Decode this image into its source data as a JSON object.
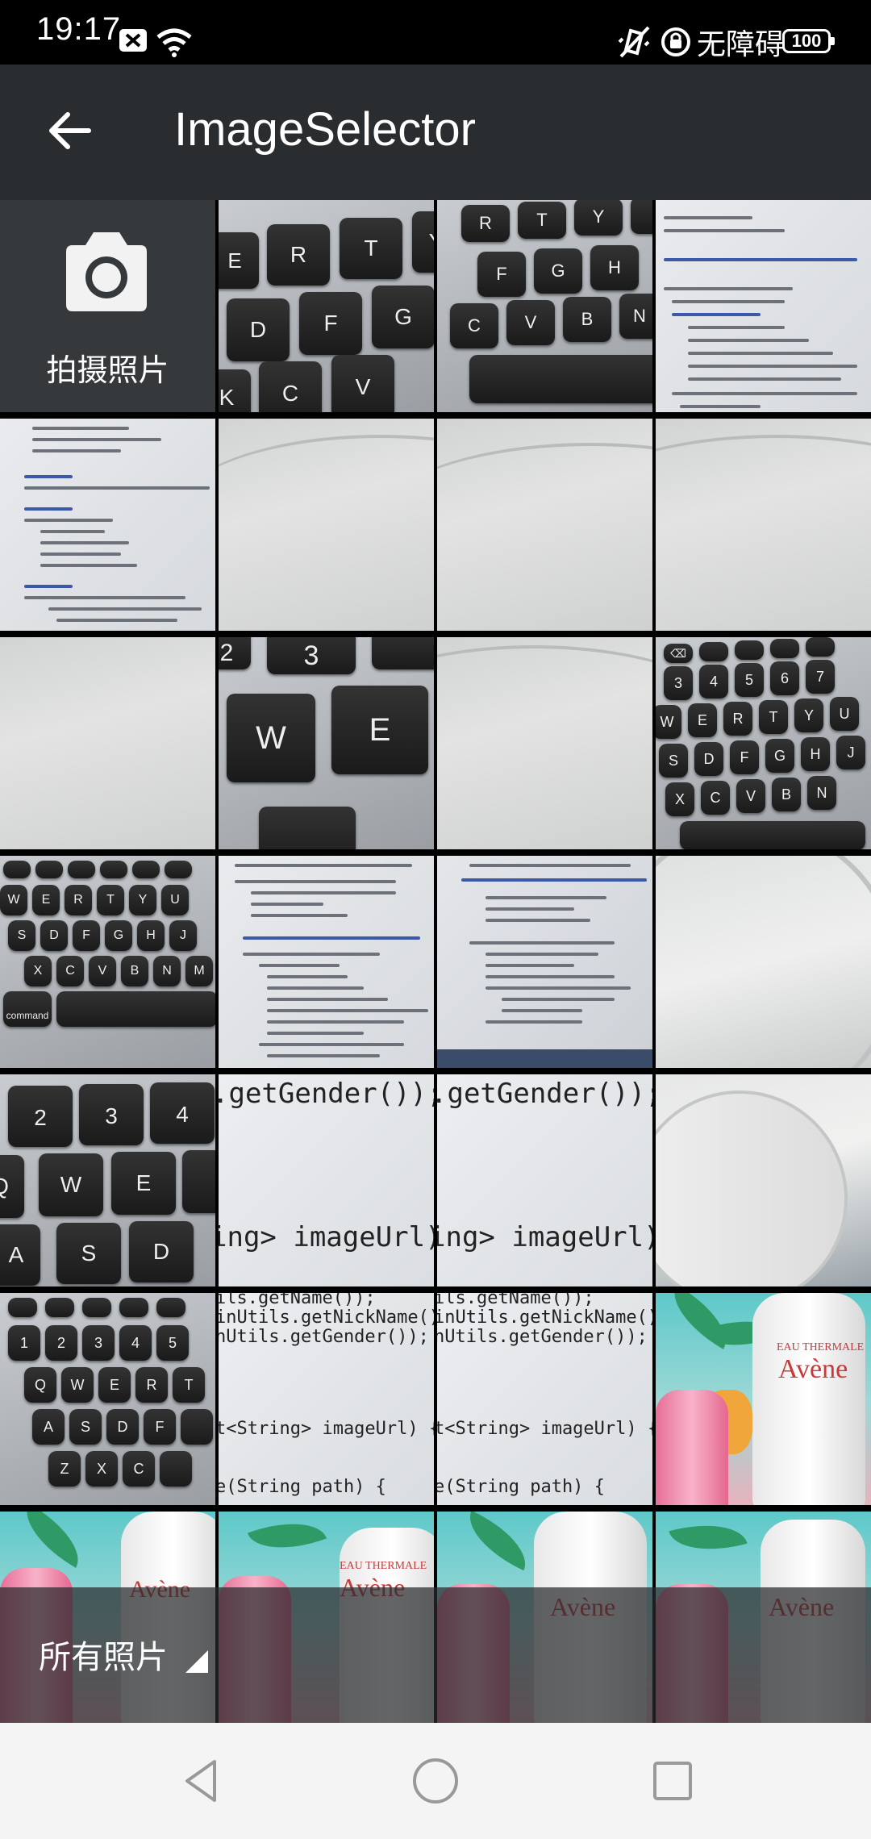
{
  "status_bar": {
    "time": "19:17",
    "accessibility_text": "无障碍",
    "battery": "100",
    "icons": [
      "notification-x-icon",
      "wifi-icon",
      "vibrate-icon",
      "lock-rotation-icon"
    ]
  },
  "app_bar": {
    "title": "ImageSelector",
    "back_icon": "arrow-back-icon"
  },
  "grid": {
    "camera_label": "拍摄照片",
    "code_texts": {
      "gender": ".getGender());",
      "image_url": "ing> imageUrl) {",
      "get_name": "ils.getName());",
      "get_nick": "inUtils.getNickName());",
      "get_gender2": "nUtils.getGender());",
      "image_url2": "t<String> imageUrl) { }",
      "path": "e(String path) {"
    },
    "brand_text": "Avène",
    "brand_sub": "EAU THERMALE"
  },
  "album_bar": {
    "album_name": "所有照片"
  },
  "nav_bar": {
    "icons": [
      "back-triangle-icon",
      "home-circle-icon",
      "recents-square-icon"
    ]
  },
  "colors": {
    "app_bar_bg": "#2a2d30",
    "camera_cell_bg": "#36393c",
    "nav_bar_bg": "#f4f4f4"
  }
}
